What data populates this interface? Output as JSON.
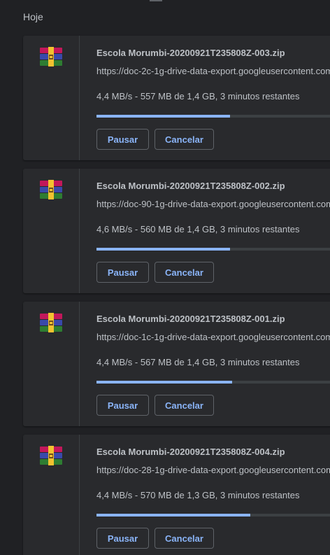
{
  "section": {
    "title": "Hoje"
  },
  "downloads": [
    {
      "file_name": "Escola Morumbi-20200921T235808Z-003.zip",
      "url": "https://doc-2c-1g-drive-data-export.googleusercontent.com",
      "status": "4,4 MB/s - 557 MB de 1,4 GB, 3 minutos restantes",
      "progress": 0.53,
      "pause_label": "Pausar",
      "cancel_label": "Cancelar",
      "icon": "winrar-archive-icon"
    },
    {
      "file_name": "Escola Morumbi-20200921T235808Z-002.zip",
      "url": "https://doc-90-1g-drive-data-export.googleusercontent.com",
      "status": "4,6 MB/s - 560 MB de 1,4 GB, 3 minutos restantes",
      "progress": 0.53,
      "pause_label": "Pausar",
      "cancel_label": "Cancelar",
      "icon": "winrar-archive-icon"
    },
    {
      "file_name": "Escola Morumbi-20200921T235808Z-001.zip",
      "url": "https://doc-1c-1g-drive-data-export.googleusercontent.com",
      "status": "4,4 MB/s - 567 MB de 1,4 GB, 3 minutos restantes",
      "progress": 0.54,
      "pause_label": "Pausar",
      "cancel_label": "Cancelar",
      "icon": "winrar-archive-icon"
    },
    {
      "file_name": "Escola Morumbi-20200921T235808Z-004.zip",
      "url": "https://doc-28-1g-drive-data-export.googleusercontent.com",
      "status": "4,4 MB/s - 570 MB de 1,3 GB, 3 minutos restantes",
      "progress": 0.61,
      "pause_label": "Pausar",
      "cancel_label": "Cancelar",
      "icon": "winrar-archive-icon"
    }
  ],
  "colors": {
    "background": "#202124",
    "card": "#292a2d",
    "accent": "#8ab4f8",
    "text": "#bdc1c6"
  }
}
